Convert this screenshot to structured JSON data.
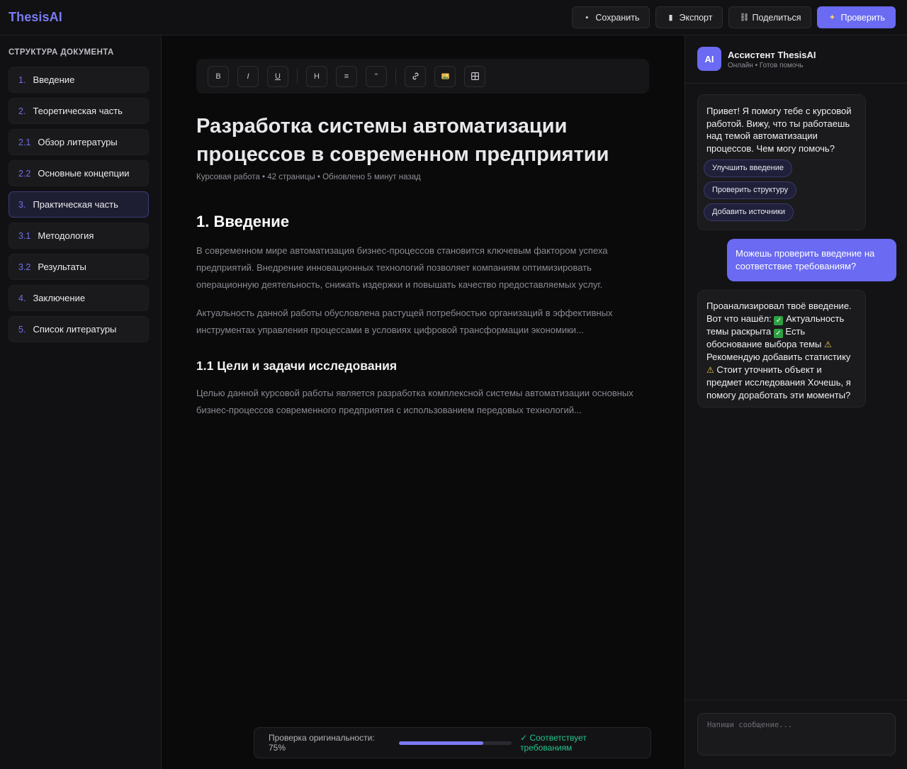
{
  "app": {
    "name": "ThesisAI"
  },
  "toolbar_top": {
    "buttons": [
      {
        "label": "Сохранить",
        "icon": "save-icon"
      },
      {
        "label": "Экспорт",
        "icon": "file-icon"
      },
      {
        "label": "Поделиться",
        "icon": "link-icon"
      },
      {
        "label": "Проверить",
        "icon": "sparkle-icon"
      }
    ]
  },
  "sidebar": {
    "title": "СТРУКТУРА ДОКУМЕНТА",
    "items": [
      {
        "num": "1.",
        "label": "Введение"
      },
      {
        "num": "2.",
        "label": "Теоретическая часть"
      },
      {
        "num": "2.1",
        "label": "Обзор литературы"
      },
      {
        "num": "2.2",
        "label": "Основные концепции"
      },
      {
        "num": "3.",
        "label": "Практическая часть",
        "active": true
      },
      {
        "num": "3.1",
        "label": "Методология"
      },
      {
        "num": "3.2",
        "label": "Результаты"
      },
      {
        "num": "4.",
        "label": "Заключение"
      },
      {
        "num": "5.",
        "label": "Список литературы"
      }
    ]
  },
  "editor": {
    "tools": [
      "B",
      "I",
      "U",
      "H",
      "≡",
      "\"",
      "🔗",
      "🖼",
      "⊞"
    ],
    "title": "Разработка системы автоматизации процессов в современном предприятии",
    "meta": "Курсовая работа • 42 страницы • Обновлено 5 минут назад",
    "h1": "1. Введение",
    "p1": "В современном мире автоматизация бизнес-процессов становится ключевым фактором успеха предприятий. Внедрение инновационных технологий позволяет компаниям оптимизировать операционную деятельность, снижать издержки и повышать качество предоставляемых услуг.",
    "p2": "Актуальность данной работы обусловлена растущей потребностью организаций в эффективных инструментах управления процессами в условиях цифровой трансформации экономики...",
    "h2": "1.1 Цели и задачи исследования",
    "p3": "Целью данной курсовой работы является разработка комплексной системы автоматизации основных бизнес-процессов современного предприятия с использованием передовых технологий..."
  },
  "originality": {
    "label": "Проверка оригинальности: 75%",
    "value": 0.75,
    "status": "✓ Соответствует требованиям",
    "status_color": "#22c58b"
  },
  "chat": {
    "avatar": "AI",
    "name": "Ассистент ThesisAI",
    "status": "Онлайн • Готов помочь",
    "msg1": "Привет! Я помогу тебе с курсовой работой. Вижу, что ты работаешь над темой автоматизации процессов. Чем могу помочь?",
    "chips": [
      "Улучшить введение",
      "Проверить структуру",
      "Добавить источники"
    ],
    "msg2": "Можешь проверить введение на соответствие требованиям?",
    "msg3": {
      "part1": "Проанализировал твоё введение. Вот что нашёл: ",
      "part2": " Актуальность темы раскрыта ",
      "part3": " Есть обоснование выбора темы ",
      "part4": " Рекомендую добавить статистику ",
      "part5": " Стоит уточнить объект и предмет исследования Хочешь, я помогу доработать эти моменты?"
    },
    "input_placeholder": "Напиши сообщение...",
    "accent": "#6a6af2"
  }
}
